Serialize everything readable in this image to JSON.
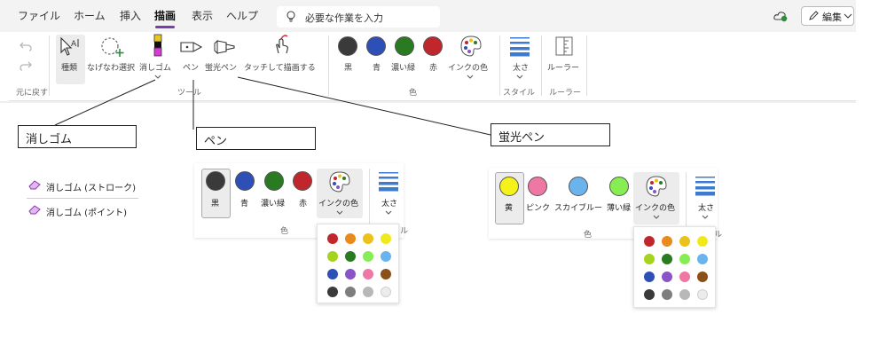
{
  "menu": {
    "items": [
      "ファイル",
      "ホーム",
      "挿入",
      "描画",
      "表示",
      "ヘルプ"
    ],
    "active": "描画",
    "search_placeholder": "必要な作業を入力",
    "edit_label": "編集"
  },
  "ribbon": {
    "undo_group_label": "元に戻す",
    "tools": [
      "種類",
      "なげなわ選択",
      "消しゴム",
      "ペン",
      "蛍光ペン",
      "タッチして描画する"
    ],
    "tools_group_label": "ツール",
    "colors": [
      {
        "label": "黒",
        "color": "#3a3a3a"
      },
      {
        "label": "青",
        "color": "#2e4fb5"
      },
      {
        "label": "濃い緑",
        "color": "#2a7a22"
      },
      {
        "label": "赤",
        "color": "#c0272d"
      }
    ],
    "ink_color_label": "インクの色",
    "color_group_label": "色",
    "thickness_label": "太さ",
    "style_group_label": "スタイル",
    "ruler_label": "ルーラー",
    "ruler_group_label": "ルーラー"
  },
  "callouts": {
    "eraser": "消しゴム",
    "pen": "ペン",
    "highlighter": "蛍光ペン"
  },
  "eraser_menu": [
    "消しゴム (ストローク)",
    "消しゴム (ポイント)"
  ],
  "pen_panel": {
    "colors": [
      {
        "label": "黒",
        "color": "#3a3a3a"
      },
      {
        "label": "青",
        "color": "#2e4fb5"
      },
      {
        "label": "濃い緑",
        "color": "#2a7a22"
      },
      {
        "label": "赤",
        "color": "#c0272d"
      }
    ],
    "ink_label": "インクの色",
    "thickness_label": "太さ",
    "group_label": "色",
    "group_label_partial": "ル"
  },
  "highlighter_panel": {
    "colors": [
      {
        "label": "黄",
        "color": "#f5f21a"
      },
      {
        "label": "ピンク",
        "color": "#ee77a3"
      },
      {
        "label": "スカイブルー",
        "color": "#6ab4ee"
      },
      {
        "label": "薄い緑",
        "color": "#86ee52"
      }
    ],
    "ink_label": "インクの色",
    "thickness_label": "太さ",
    "group_label": "色",
    "group_label_partial": "ル"
  },
  "palette_colors": [
    "#c0272d",
    "#ea8a1c",
    "#ebc21a",
    "#f1ea1a",
    "#a6d41c",
    "#2a7a22",
    "#86ee52",
    "#6ab4ee",
    "#2e4fb5",
    "#8a54c8",
    "#ee77a3",
    "#8a5018",
    "#3a3a3a",
    "#7e7e7e",
    "#b8b8b8",
    "#ececec"
  ]
}
